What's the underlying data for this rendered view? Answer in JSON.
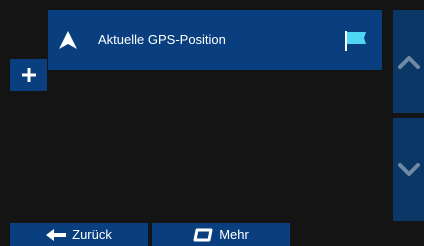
{
  "route": {
    "start_label": "Aktuelle GPS-Position",
    "start_icon": "navigation-arrow-icon",
    "destination_icon": "flag-icon"
  },
  "toolbar": {
    "add_icon": "plus-icon",
    "back_label": "Zurück",
    "back_icon": "arrow-left-icon",
    "more_label": "Mehr",
    "more_icon": "more-options-icon"
  },
  "scroll": {
    "up_icon": "chevron-up-icon",
    "down_icon": "chevron-down-icon"
  },
  "colors": {
    "background": "#141414",
    "button_blue": "#0a3f7f",
    "scroll_blue": "#0b3766",
    "flag_cyan": "#4fd6f2",
    "chevron": "#6f8aa6",
    "text": "#ffffff"
  }
}
